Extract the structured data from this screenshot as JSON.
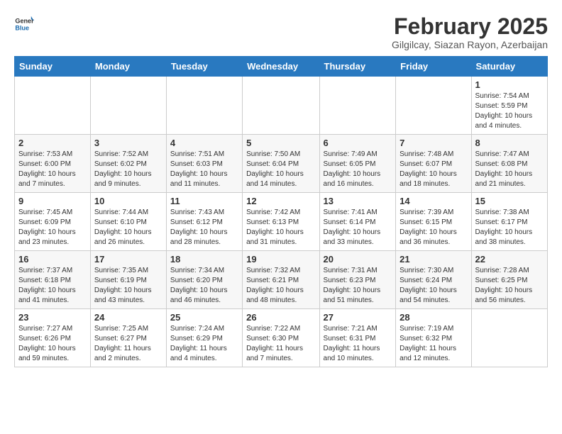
{
  "logo": {
    "text_general": "General",
    "text_blue": "Blue"
  },
  "header": {
    "month_year": "February 2025",
    "location": "Gilgilcay, Siazan Rayon, Azerbaijan"
  },
  "days_of_week": [
    "Sunday",
    "Monday",
    "Tuesday",
    "Wednesday",
    "Thursday",
    "Friday",
    "Saturday"
  ],
  "weeks": [
    [
      {
        "day": "",
        "info": ""
      },
      {
        "day": "",
        "info": ""
      },
      {
        "day": "",
        "info": ""
      },
      {
        "day": "",
        "info": ""
      },
      {
        "day": "",
        "info": ""
      },
      {
        "day": "",
        "info": ""
      },
      {
        "day": "1",
        "info": "Sunrise: 7:54 AM\nSunset: 5:59 PM\nDaylight: 10 hours and 4 minutes."
      }
    ],
    [
      {
        "day": "2",
        "info": "Sunrise: 7:53 AM\nSunset: 6:00 PM\nDaylight: 10 hours and 7 minutes."
      },
      {
        "day": "3",
        "info": "Sunrise: 7:52 AM\nSunset: 6:02 PM\nDaylight: 10 hours and 9 minutes."
      },
      {
        "day": "4",
        "info": "Sunrise: 7:51 AM\nSunset: 6:03 PM\nDaylight: 10 hours and 11 minutes."
      },
      {
        "day": "5",
        "info": "Sunrise: 7:50 AM\nSunset: 6:04 PM\nDaylight: 10 hours and 14 minutes."
      },
      {
        "day": "6",
        "info": "Sunrise: 7:49 AM\nSunset: 6:05 PM\nDaylight: 10 hours and 16 minutes."
      },
      {
        "day": "7",
        "info": "Sunrise: 7:48 AM\nSunset: 6:07 PM\nDaylight: 10 hours and 18 minutes."
      },
      {
        "day": "8",
        "info": "Sunrise: 7:47 AM\nSunset: 6:08 PM\nDaylight: 10 hours and 21 minutes."
      }
    ],
    [
      {
        "day": "9",
        "info": "Sunrise: 7:45 AM\nSunset: 6:09 PM\nDaylight: 10 hours and 23 minutes."
      },
      {
        "day": "10",
        "info": "Sunrise: 7:44 AM\nSunset: 6:10 PM\nDaylight: 10 hours and 26 minutes."
      },
      {
        "day": "11",
        "info": "Sunrise: 7:43 AM\nSunset: 6:12 PM\nDaylight: 10 hours and 28 minutes."
      },
      {
        "day": "12",
        "info": "Sunrise: 7:42 AM\nSunset: 6:13 PM\nDaylight: 10 hours and 31 minutes."
      },
      {
        "day": "13",
        "info": "Sunrise: 7:41 AM\nSunset: 6:14 PM\nDaylight: 10 hours and 33 minutes."
      },
      {
        "day": "14",
        "info": "Sunrise: 7:39 AM\nSunset: 6:15 PM\nDaylight: 10 hours and 36 minutes."
      },
      {
        "day": "15",
        "info": "Sunrise: 7:38 AM\nSunset: 6:17 PM\nDaylight: 10 hours and 38 minutes."
      }
    ],
    [
      {
        "day": "16",
        "info": "Sunrise: 7:37 AM\nSunset: 6:18 PM\nDaylight: 10 hours and 41 minutes."
      },
      {
        "day": "17",
        "info": "Sunrise: 7:35 AM\nSunset: 6:19 PM\nDaylight: 10 hours and 43 minutes."
      },
      {
        "day": "18",
        "info": "Sunrise: 7:34 AM\nSunset: 6:20 PM\nDaylight: 10 hours and 46 minutes."
      },
      {
        "day": "19",
        "info": "Sunrise: 7:32 AM\nSunset: 6:21 PM\nDaylight: 10 hours and 48 minutes."
      },
      {
        "day": "20",
        "info": "Sunrise: 7:31 AM\nSunset: 6:23 PM\nDaylight: 10 hours and 51 minutes."
      },
      {
        "day": "21",
        "info": "Sunrise: 7:30 AM\nSunset: 6:24 PM\nDaylight: 10 hours and 54 minutes."
      },
      {
        "day": "22",
        "info": "Sunrise: 7:28 AM\nSunset: 6:25 PM\nDaylight: 10 hours and 56 minutes."
      }
    ],
    [
      {
        "day": "23",
        "info": "Sunrise: 7:27 AM\nSunset: 6:26 PM\nDaylight: 10 hours and 59 minutes."
      },
      {
        "day": "24",
        "info": "Sunrise: 7:25 AM\nSunset: 6:27 PM\nDaylight: 11 hours and 2 minutes."
      },
      {
        "day": "25",
        "info": "Sunrise: 7:24 AM\nSunset: 6:29 PM\nDaylight: 11 hours and 4 minutes."
      },
      {
        "day": "26",
        "info": "Sunrise: 7:22 AM\nSunset: 6:30 PM\nDaylight: 11 hours and 7 minutes."
      },
      {
        "day": "27",
        "info": "Sunrise: 7:21 AM\nSunset: 6:31 PM\nDaylight: 11 hours and 10 minutes."
      },
      {
        "day": "28",
        "info": "Sunrise: 7:19 AM\nSunset: 6:32 PM\nDaylight: 11 hours and 12 minutes."
      },
      {
        "day": "",
        "info": ""
      }
    ]
  ]
}
